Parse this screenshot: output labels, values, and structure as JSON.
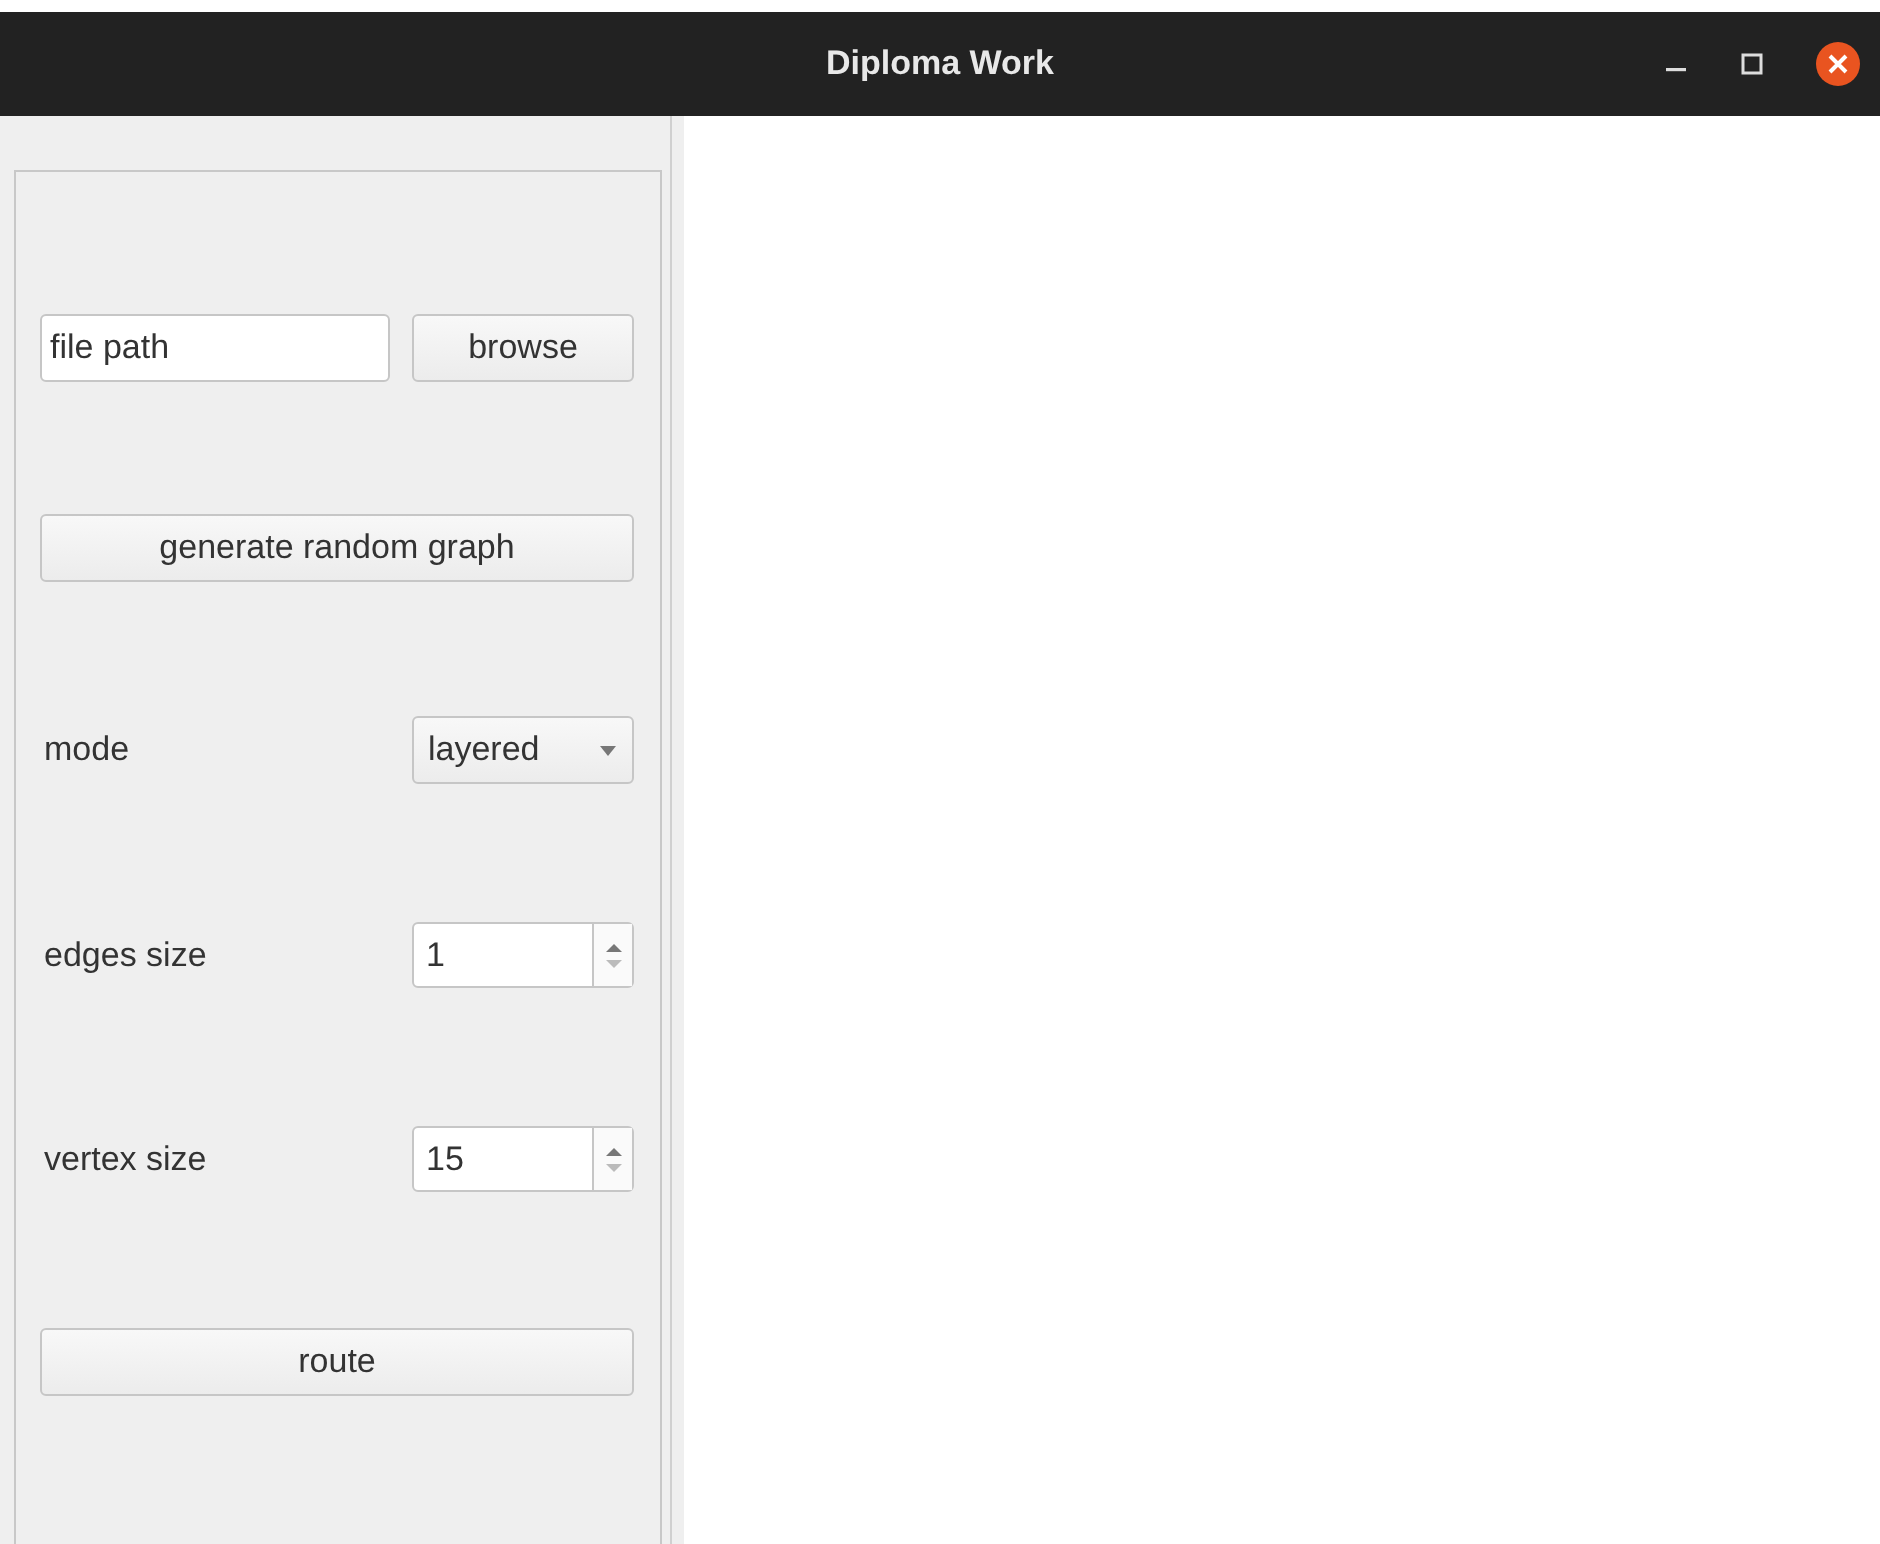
{
  "window": {
    "title": "Diploma Work"
  },
  "file_path": {
    "value": "file path"
  },
  "browse_button": "browse",
  "generate_button": "generate random graph",
  "mode": {
    "label": "mode",
    "value": "layered"
  },
  "spinboxes": [
    {
      "label": "edges size",
      "value": "1"
    },
    {
      "label": "vertex size",
      "value": "15"
    }
  ],
  "route_button": "route"
}
